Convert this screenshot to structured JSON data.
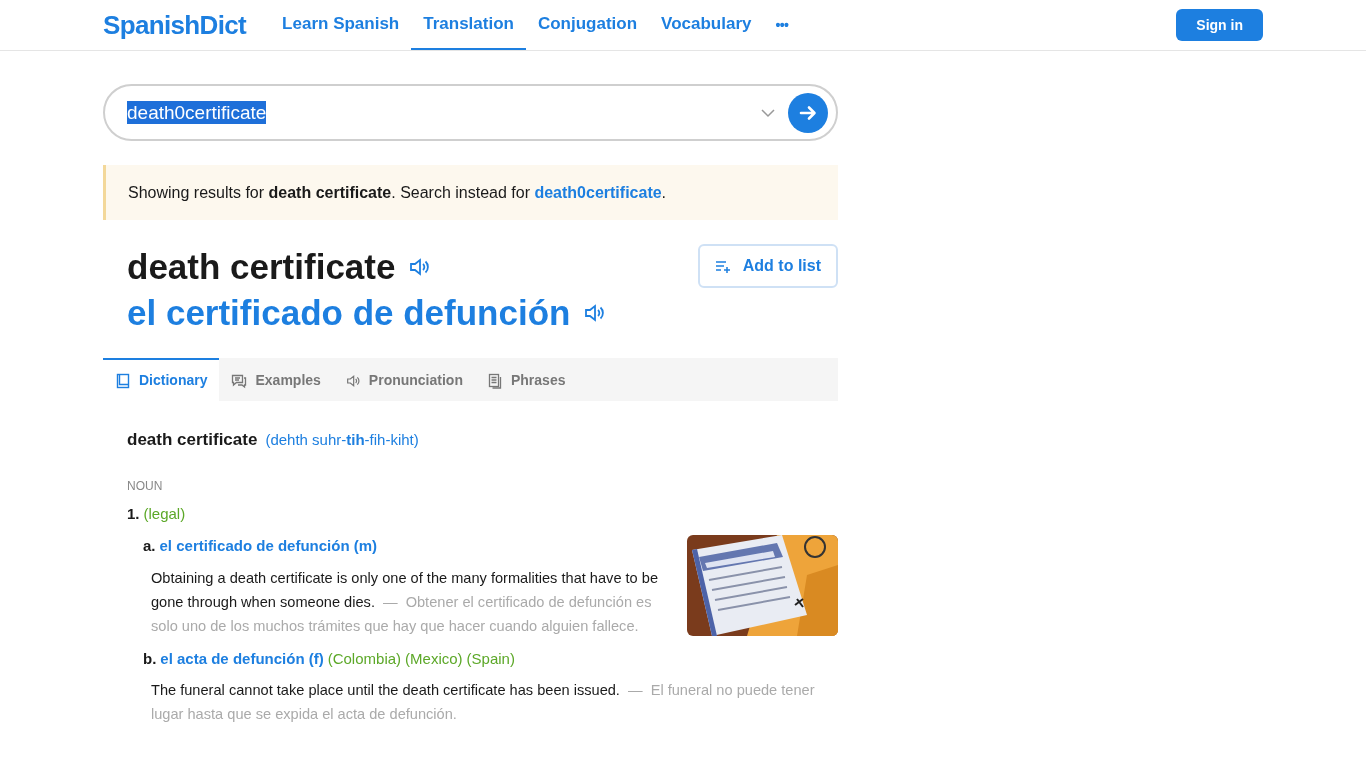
{
  "header": {
    "logo": "SpanishDict",
    "nav": [
      {
        "label": "Learn Spanish",
        "selected": false
      },
      {
        "label": "Translation",
        "selected": true
      },
      {
        "label": "Conjugation",
        "selected": false
      },
      {
        "label": "Vocabulary",
        "selected": false
      }
    ],
    "more": "•••",
    "sign_in": "Sign in"
  },
  "search": {
    "value": "death0certificate"
  },
  "notice": {
    "text": "Showing results for **death certificate**. Search instead for",
    "link": "death0certificate",
    "end": "."
  },
  "headword": {
    "term": "death certificate",
    "translation": "el certificado de defunción",
    "add_to_list": "Add to list"
  },
  "tabs": [
    {
      "label": "Dictionary",
      "kind": "book",
      "selected": true
    },
    {
      "label": "Examples",
      "kind": "chat",
      "selected": false
    },
    {
      "label": "Pronunciation",
      "kind": "sound",
      "selected": false
    },
    {
      "label": "Phrases",
      "kind": "doc",
      "selected": false
    }
  ],
  "entry": {
    "word": "death certificate",
    "pronunciation": "(dehth suhr-**tih**-fih-kiht)",
    "part_of_speech": "NOUN",
    "senses": [
      {
        "number": "1.",
        "context": "(legal)",
        "translations": [
          {
            "letter": "a.",
            "translation": "el certificado de defunción (m)",
            "example_en": "Obtaining a death certificate is only one of the many formalities that have to be gone through when someone dies.",
            "dash": "—",
            "example_es": "Obtener el certificado de defunción es solo uno de los muchos trámites que hay que hacer cuando alguien fallece."
          },
          {
            "letter": "b.",
            "translation": "el acta de defunción (f)",
            "regions": [
              "(Colombia)",
              "(Mexico)",
              "(Spain)"
            ],
            "example_en": "The funeral cannot take place until the death certificate has been issued.",
            "dash": "—",
            "example_es": "El funeral no puede tener lugar hasta que se expida el acta de defunción."
          }
        ]
      }
    ]
  }
}
